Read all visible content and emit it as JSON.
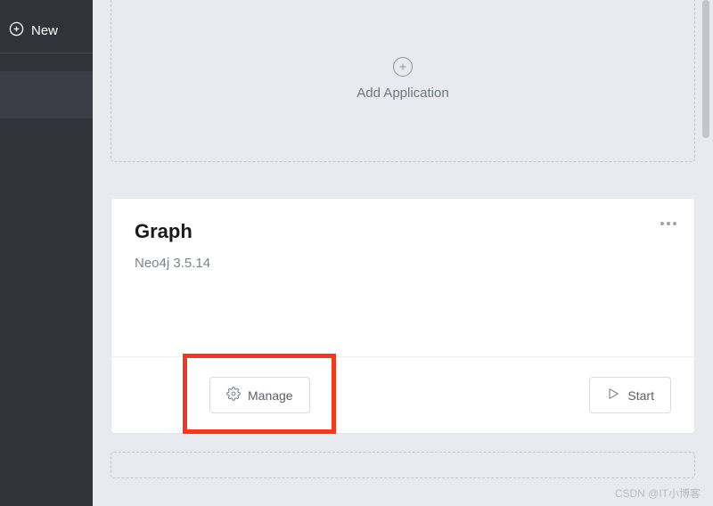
{
  "sidebar": {
    "new_label": "New"
  },
  "add_card": {
    "label": "Add Application"
  },
  "graph_card": {
    "title": "Graph",
    "version": "Neo4j 3.5.14",
    "manage_label": "Manage",
    "start_label": "Start"
  },
  "watermark": "CSDN @IT小博客"
}
